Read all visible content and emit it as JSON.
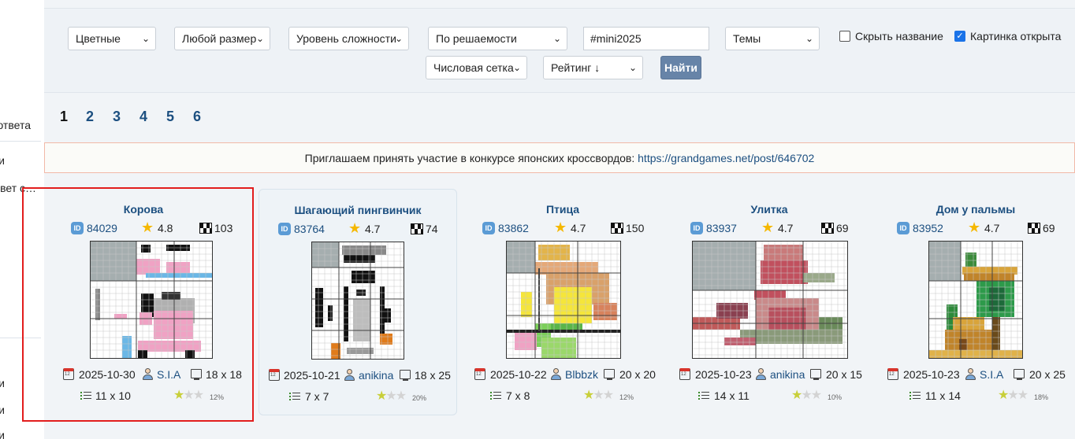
{
  "sidebar": {
    "items": [
      "ответа",
      "и",
      "ответ с…",
      "и",
      "и",
      "и"
    ]
  },
  "filters": {
    "color": "Цветные",
    "size": "Любой размер",
    "difficulty": "Уровень сложности",
    "solvability": "По решаемости",
    "tag": "#mini2025",
    "themes": "Темы",
    "hide_title": "Скрыть название",
    "hide_title_checked": false,
    "picture_open": "Картинка открыта",
    "picture_open_checked": true,
    "grid_type": "Числовая сетка",
    "sort": "Рейтинг ↓",
    "find": "Найти"
  },
  "pagination": {
    "pages": [
      "1",
      "2",
      "3",
      "4",
      "5",
      "6"
    ],
    "current": "1"
  },
  "banner": {
    "text": "Приглашаем принять участие в конкурсе японских кроссвордов: ",
    "link": "https://grandgames.net/post/646702"
  },
  "cards": [
    {
      "title": "Корова",
      "id_badge": "ID",
      "id": "84029",
      "rating": "4.8",
      "solved": "103",
      "date": "2025-10-30",
      "author": "S.I.A",
      "size": "18 x 18",
      "clues": "11 x 10",
      "percent": "12%",
      "stars_filled": 1
    },
    {
      "title": "Шагающий пингвинчик",
      "id_badge": "ID",
      "id": "83764",
      "rating": "4.7",
      "solved": "74",
      "date": "2025-10-21",
      "author": "anikina",
      "size": "18 x 25",
      "clues": "7 x 7",
      "percent": "20%",
      "stars_filled": 1
    },
    {
      "title": "Птица",
      "id_badge": "ID",
      "id": "83862",
      "rating": "4.7",
      "solved": "150",
      "date": "2025-10-22",
      "author": "Blbbzk",
      "size": "20 x 20",
      "clues": "7 x 8",
      "percent": "12%",
      "stars_filled": 1
    },
    {
      "title": "Улитка",
      "id_badge": "ID",
      "id": "83937",
      "rating": "4.7",
      "solved": "69",
      "date": "2025-10-23",
      "author": "anikina",
      "size": "20 x 15",
      "clues": "14 x 11",
      "percent": "10%",
      "stars_filled": 1
    },
    {
      "title": "Дом у пальмы",
      "id_badge": "ID",
      "id": "83952",
      "rating": "4.7",
      "solved": "69",
      "date": "2025-10-23",
      "author": "S.I.A",
      "size": "20 x 25",
      "clues": "11 x 14",
      "percent": "18%",
      "stars_filled": 1
    }
  ],
  "colors": {
    "link": "#1c4f80",
    "accent_button": "#6784a8",
    "selection": "#e21d1d",
    "banner_border": "#f1b9a8"
  }
}
